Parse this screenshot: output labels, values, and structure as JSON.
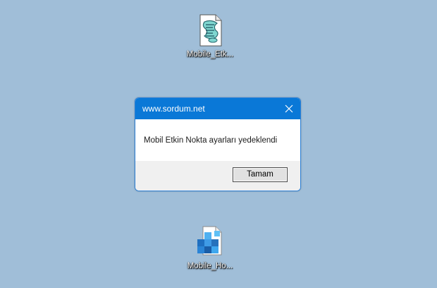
{
  "desktop": {
    "background": "#a0bed8",
    "icons": [
      {
        "label": "Mobile_Etk...",
        "icon": "script-file-icon"
      },
      {
        "label": "Mobile_Ho...",
        "icon": "registry-file-icon"
      }
    ]
  },
  "dialog": {
    "title": "www.sordum.net",
    "message": "Mobil Etkin Nokta ayarları yedeklendi",
    "ok_label": "Tamam",
    "accent": "#0a78d7",
    "close_icon": "close-icon"
  }
}
